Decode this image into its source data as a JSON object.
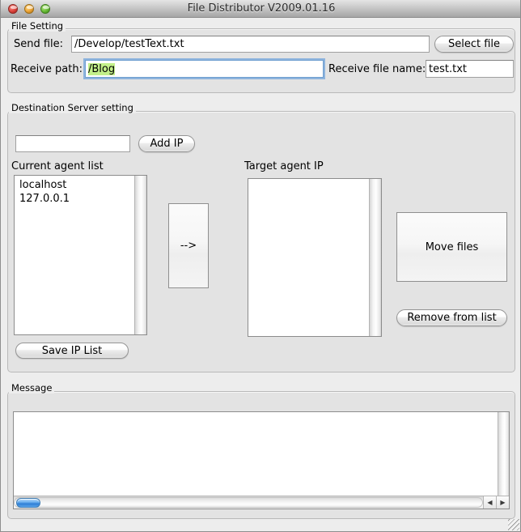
{
  "window": {
    "title": "File Distributor V2009.01.16",
    "traffic_lights": [
      "close",
      "minimize",
      "maximize"
    ]
  },
  "file_setting": {
    "group_label": "File Setting",
    "send_file_label": "Send file:",
    "send_file_value": "/Develop/testText.txt",
    "send_file_placeholder": "",
    "select_file_button": "Select file",
    "receive_path_label": "Receive path:",
    "receive_path_value": "/Blog",
    "receive_path_placeholder": "",
    "receive_file_name_label": "Receive file name:",
    "receive_file_name_value": "test.txt",
    "receive_file_name_placeholder": ""
  },
  "destination": {
    "group_label": "Destination Server setting",
    "add_ip_input_value": "",
    "add_ip_input_placeholder": "",
    "add_ip_button": "Add IP",
    "current_list_label": "Current agent list",
    "current_list_items": [
      "localhost",
      "127.0.0.1"
    ],
    "target_list_label": "Target agent IP",
    "target_list_items": [],
    "move_right_button": "-->",
    "move_files_button": "Move files",
    "remove_from_list_button": "Remove from list",
    "save_ip_list_button": "Save IP List"
  },
  "message": {
    "group_label": "Message",
    "text": ""
  },
  "scrollbars": {
    "left_arrow": "◀",
    "right_arrow": "▶"
  },
  "colors": {
    "selection_highlight": "#c3f08a",
    "focus_ring": "#72a4db",
    "scroll_thumb": "#2f7fd6",
    "window_background": "#ededed",
    "group_background": "#e3e3e3"
  }
}
